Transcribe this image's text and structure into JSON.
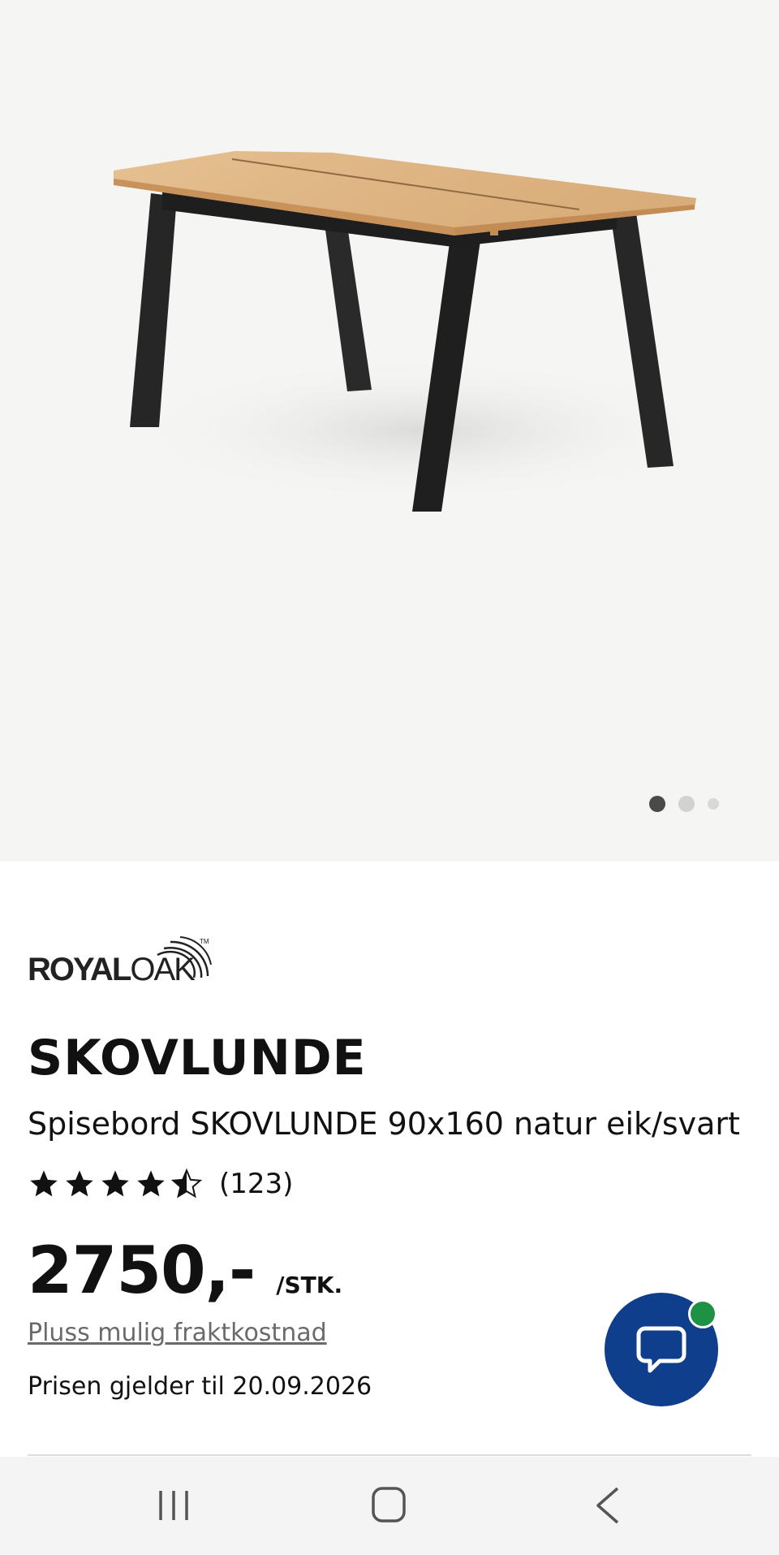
{
  "gallery": {
    "image_alt": "Spisebord SKOVLUNDE 90x160 natur eik/svart",
    "current_image": 1,
    "image_count": 3
  },
  "product": {
    "brand": {
      "part1": "ROYAL",
      "part2": "OAK",
      "tm": "TM"
    },
    "name": "SKOVLUNDE",
    "description": "Spisebord SKOVLUNDE 90x160 natur eik/svart",
    "rating": 4.5,
    "review_count": "(123)",
    "price": "2750,-",
    "price_unit": "/STK.",
    "shipping_link": "Pluss mulig fraktkostnad",
    "price_valid": "Prisen gjelder til 20.09.2026"
  },
  "chat": {
    "icon": "chat-bubble-icon",
    "status": "online",
    "status_color": "#1f9144",
    "color": "#0f3e8c"
  },
  "system_nav": {
    "recents_icon": "recent-apps-icon",
    "home_icon": "home-icon",
    "back_icon": "back-icon"
  }
}
